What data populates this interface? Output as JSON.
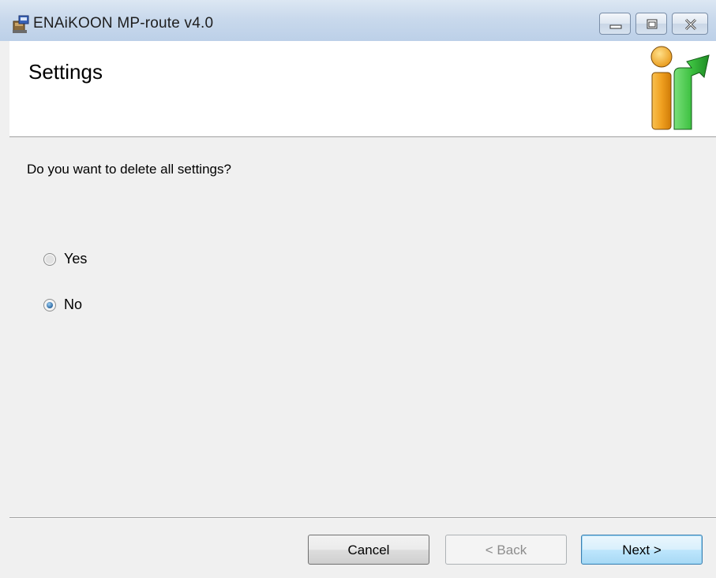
{
  "window": {
    "title": "ENAiKOON MP-route v4.0",
    "app_icon": "installer-icon",
    "controls": {
      "minimize_icon": "minimize-icon",
      "maximize_icon": "maximize-icon",
      "close_icon": "close-icon"
    }
  },
  "banner": {
    "title": "Settings",
    "logo": "enaikoon-logo"
  },
  "body": {
    "question": "Do you want to delete all settings?",
    "options": [
      {
        "label": "Yes",
        "checked": false
      },
      {
        "label": "No",
        "checked": true
      }
    ]
  },
  "footer": {
    "cancel_label": "Cancel",
    "back_label": "< Back",
    "next_label": "Next >"
  },
  "colors": {
    "titlebar": "#c9d9ec",
    "dialog_bg": "#f0f0f0",
    "logo_orange": "#f0a020",
    "logo_green": "#3cc040",
    "next_border": "#3c7fb1"
  }
}
